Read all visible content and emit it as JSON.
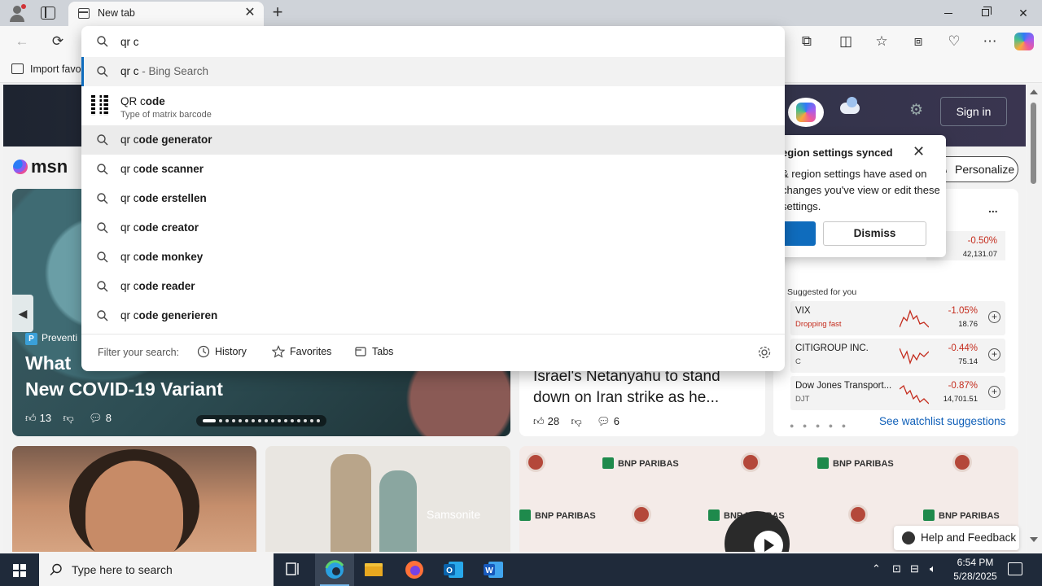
{
  "browser": {
    "tab_title": "New tab",
    "new_tab": "+",
    "close_tab": "✕",
    "favorites_import": "Import favo"
  },
  "omnibox": {
    "query": "qr c",
    "suggestions": [
      {
        "prefix": "qr c",
        "bold": "",
        "suffix": " - Bing Search"
      },
      {
        "prefix": "qr c",
        "bold": "ode generator",
        "suffix": ""
      },
      {
        "prefix": "qr c",
        "bold": "ode scanner",
        "suffix": ""
      },
      {
        "prefix": "qr c",
        "bold": "ode erstellen",
        "suffix": ""
      },
      {
        "prefix": "qr c",
        "bold": "ode creator",
        "suffix": ""
      },
      {
        "prefix": "qr c",
        "bold": "ode monkey",
        "suffix": ""
      },
      {
        "prefix": "qr c",
        "bold": "ode reader",
        "suffix": ""
      },
      {
        "prefix": "qr c",
        "bold": "ode generieren",
        "suffix": ""
      }
    ],
    "entity": {
      "title_prefix": "QR c",
      "title_rest": "ode",
      "subtitle": "Type of matrix barcode"
    },
    "filter_label": "Filter your search:",
    "filters": {
      "history": "History",
      "favorites": "Favorites",
      "tabs": "Tabs"
    }
  },
  "msn": {
    "logo": "msn",
    "sign_in": "Sign in",
    "personalize": "Personalize",
    "hero": {
      "provider": "Preventi",
      "title_line1": "What",
      "title_line2": "New COVID-19 Variant",
      "likes": "13",
      "comments": "8"
    },
    "news2": {
      "title": "Israel's Netanyahu to stand down on Iran strike as he...",
      "likes": "28",
      "comments": "6"
    },
    "notification": {
      "title": "egion settings synced",
      "text": "& region settings have ased on changes you've view or edit these settings.",
      "dismiss": "Dismiss"
    },
    "watchlist": {
      "more": "...",
      "first": {
        "pct": "-0.50%",
        "val": "42,131.07"
      },
      "suggested_label": "Suggested for you",
      "items": [
        {
          "name": "VIX",
          "sub": "Dropping fast",
          "pct": "-1.05%",
          "val": "18.76"
        },
        {
          "name": "CITIGROUP INC.",
          "sub": "C",
          "pct": "-0.44%",
          "val": "75.14"
        },
        {
          "name": "Dow Jones Transport...",
          "sub": "DJT",
          "pct": "-0.87%",
          "val": "14,701.51"
        }
      ],
      "see_suggestions": "See watchlist suggestions"
    },
    "samsonite": "Samsonite",
    "bnp": "BNP PARIBAS",
    "help": "Help and Feedback"
  },
  "taskbar": {
    "search_placeholder": "Type here to search",
    "time": "6:54 PM",
    "date": "5/28/2025"
  },
  "colors": {
    "accent": "#0f6cbd",
    "negative": "#c42b1c",
    "link": "#0f5fb8"
  }
}
